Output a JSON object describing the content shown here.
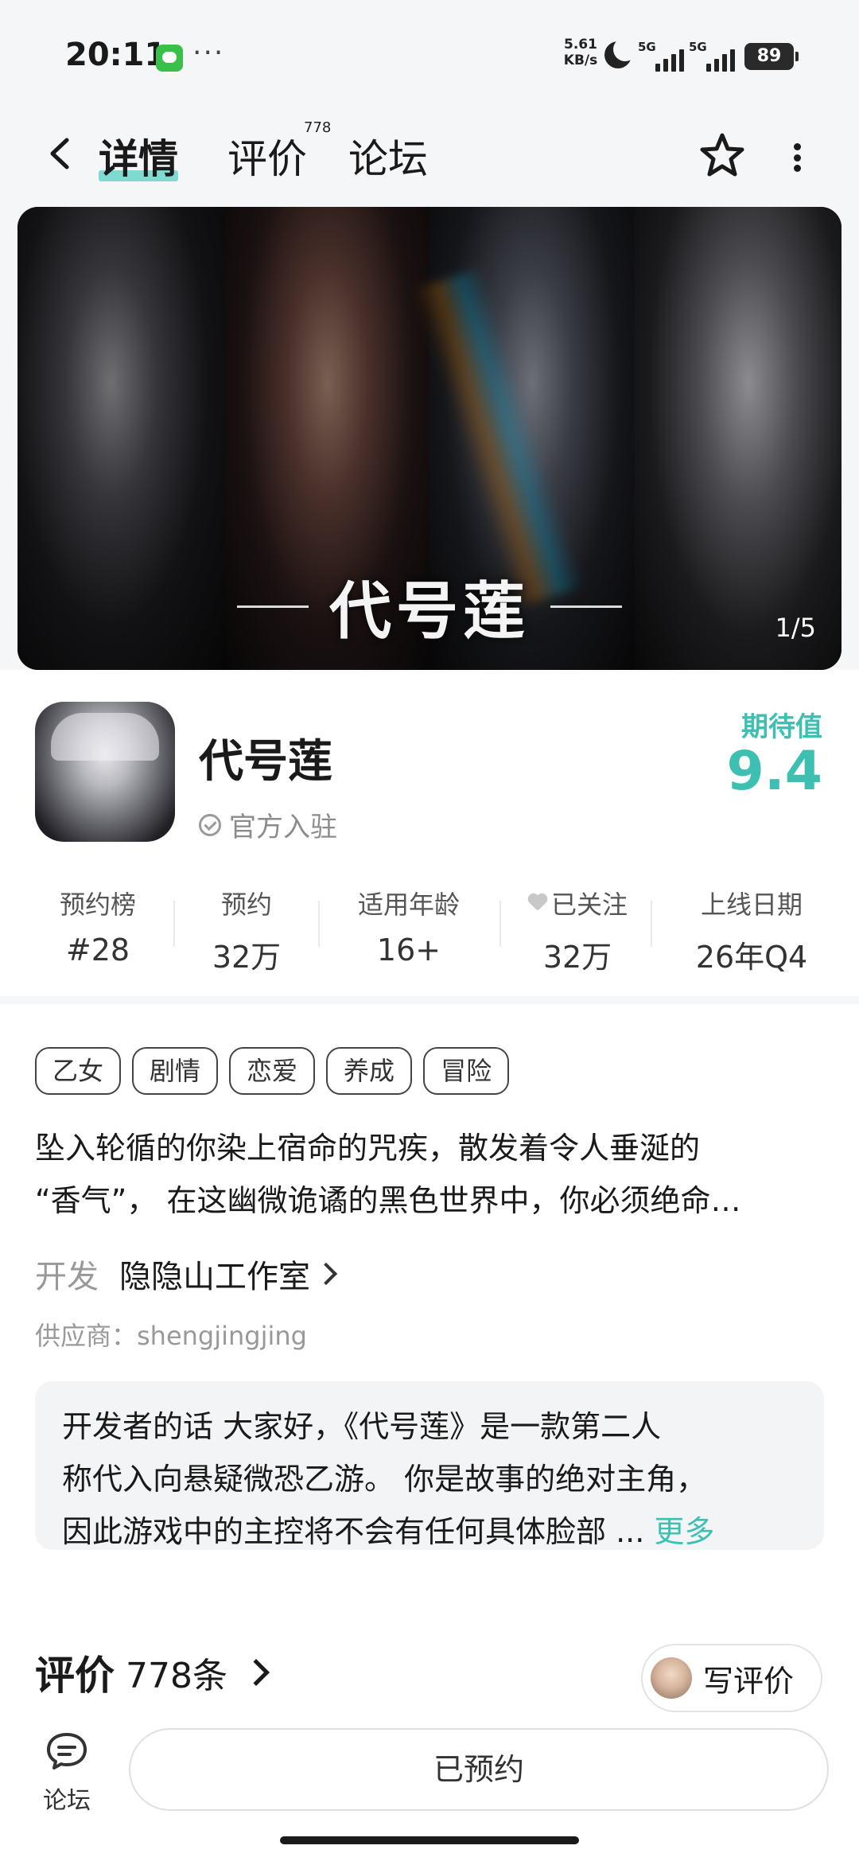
{
  "status_bar": {
    "time": "20:11",
    "more": "···",
    "speed_value": "5.61",
    "speed_unit": "KB/s",
    "net1": "5G",
    "net2": "5G",
    "battery": "89",
    "icons": [
      "wechat-icon",
      "moon-icon",
      "signal-icon",
      "battery-icon"
    ]
  },
  "nav": {
    "tabs": [
      {
        "label": "详情",
        "active": true
      },
      {
        "label": "评价",
        "badge": "778"
      },
      {
        "label": "论坛"
      }
    ],
    "icons": [
      "back-icon",
      "star-icon",
      "more-vertical-icon"
    ]
  },
  "banner": {
    "title": "代号莲",
    "counter": "1/5"
  },
  "app": {
    "name": "代号莲",
    "official_label": "官方入驻",
    "expect_label": "期待值",
    "expect_score": "9.4",
    "accent_color": "#3dbfb2"
  },
  "stats": [
    {
      "label": "预约榜",
      "value": "#28"
    },
    {
      "label": "预约",
      "value": "32万"
    },
    {
      "label": "适用年龄",
      "value": "16+"
    },
    {
      "label": "已关注",
      "value": "32万"
    },
    {
      "label": "上线日期",
      "value": "26年Q4"
    }
  ],
  "tags": [
    "乙女",
    "剧情",
    "恋爱",
    "养成",
    "冒险"
  ],
  "description": {
    "line1": "坠入轮循的你染上宿命的咒疾，散发着令人垂涎的",
    "line2": "“香气”， 在这幽微诡谲的黑色世界中，你必须绝命…"
  },
  "developer": {
    "label": "开发",
    "name": "隐隐山工作室"
  },
  "supplier": "供应商：shengjingjing",
  "dev_words": {
    "line1": "开发者的话  大家好，《代号莲》是一款第二人",
    "line2": "称代入向悬疑微恐乙游。 你是故事的绝对主角，",
    "line3": "因此游戏中的主控将不会有任何具体脸部 ...",
    "more": "更多"
  },
  "reviews": {
    "title": "评价",
    "count": "778条",
    "write_label": "写评价"
  },
  "bottom": {
    "forum_label": "论坛",
    "reserved_label": "已预约"
  }
}
